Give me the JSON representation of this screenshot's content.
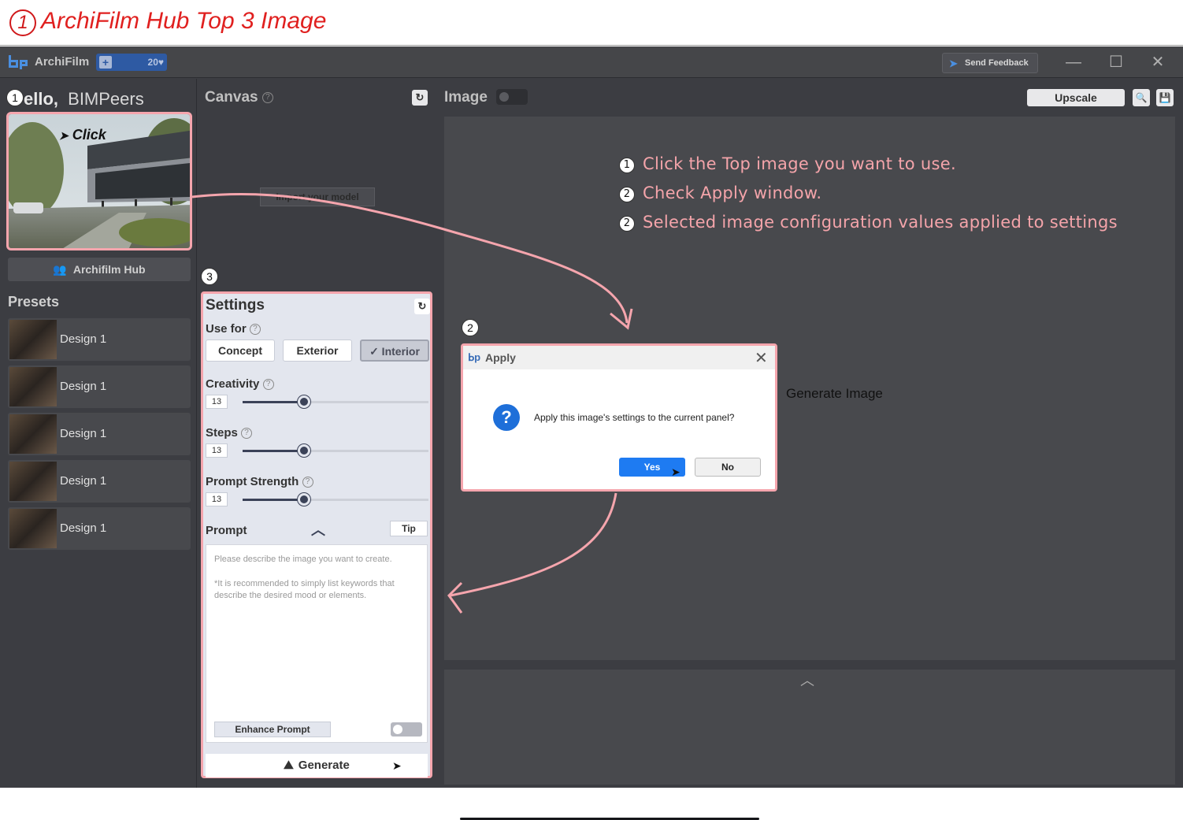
{
  "banner": {
    "number": "1",
    "title": "ArchiFilm Hub Top 3 Image"
  },
  "titlebar": {
    "app_name": "ArchiFilm",
    "credits_count": "20",
    "feedback_label": "Send Feedback",
    "minimize": "—",
    "maximize": "☐",
    "close": "✕"
  },
  "left": {
    "hello_prefix": "ello,",
    "user": "BIMPeers",
    "click_label": "Click",
    "hub_button": "Archifilm Hub",
    "presets_title": "Presets",
    "presets": [
      {
        "label": "Design 1"
      },
      {
        "label": "Design 1"
      },
      {
        "label": "Design 1"
      },
      {
        "label": "Design 1"
      },
      {
        "label": "Design 1"
      }
    ]
  },
  "canvas": {
    "title": "Canvas",
    "import_label": "Import your model"
  },
  "settings": {
    "title": "Settings",
    "use_for_label": "Use for",
    "use_for_options": [
      "Concept",
      "Exterior",
      "✓ Interior"
    ],
    "creativity_label": "Creativity",
    "creativity_value": "13",
    "creativity_level": 0.33,
    "steps_label": "Steps",
    "steps_value": "13",
    "steps_level": 0.33,
    "strength_label": "Prompt Strength",
    "strength_value": "13",
    "strength_level": 0.33,
    "prompt_label": "Prompt",
    "tip_label": "Tip",
    "placeholder_line1": "Please describe the image you want to create.",
    "placeholder_line2": "*It is recommended to simply list keywords that describe the desired mood or elements.",
    "enhance_label": "Enhance Prompt",
    "generate_label": "Generate"
  },
  "image": {
    "title": "Image",
    "upscale_label": "Upscale",
    "generate_text": "Generate Image"
  },
  "notes": [
    {
      "num": "1",
      "text": "Click the Top image you want to use."
    },
    {
      "num": "2",
      "text": "Check Apply window."
    },
    {
      "num": "2",
      "text": "Selected image configuration values applied to settings"
    }
  ],
  "markers": {
    "m1": "1",
    "m2": "2",
    "m3": "3"
  },
  "dialog": {
    "title": "Apply",
    "message": "Apply this image's settings to the current panel?",
    "yes": "Yes",
    "no": "No"
  },
  "colors": {
    "annotation_pink": "#f4a4aa",
    "banner_red": "#e0201f",
    "accent_blue": "#1e7bf2",
    "app_bg": "#3c3d42"
  }
}
